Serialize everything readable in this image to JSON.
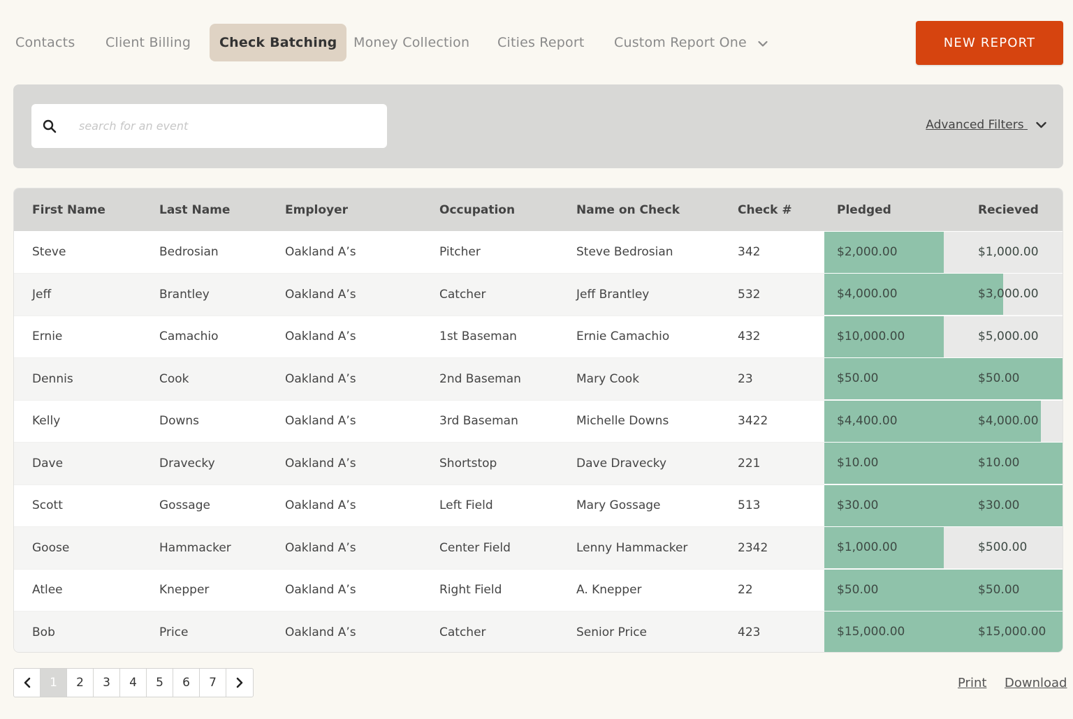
{
  "tabs": [
    {
      "label": "Contacts"
    },
    {
      "label": "Client Billing"
    },
    {
      "label": "Check Batching"
    },
    {
      "label": "Money Collection"
    },
    {
      "label": "Cities Report"
    },
    {
      "label": "Custom Report One"
    }
  ],
  "active_tab": "Check Batching",
  "new_report_label": "NEW REPORT",
  "search": {
    "placeholder": "search for an event",
    "value": ""
  },
  "advanced_filters_label": "Advanced Filters",
  "table": {
    "columns": [
      "First Name",
      "Last Name",
      "Employer",
      "Occupation",
      "Name on Check",
      "Check #",
      "Pledged",
      "Recieved"
    ],
    "rows": [
      {
        "first": "Steve",
        "last": "Bedrosian",
        "employer": "Oakland A’s",
        "occupation": "Pitcher",
        "name_on_check": "Steve Bedrosian",
        "check": "342",
        "pledged": "$2,000.00",
        "received": "$1,000.00",
        "received_fraction": 0.5
      },
      {
        "first": "Jeff",
        "last": "Brantley",
        "employer": "Oakland A’s",
        "occupation": "Catcher",
        "name_on_check": "Jeff Brantley",
        "check": "532",
        "pledged": "$4,000.00",
        "received": "$3,000.00",
        "received_fraction": 0.75
      },
      {
        "first": "Ernie",
        "last": "Camachio",
        "employer": "Oakland A’s",
        "occupation": "1st Baseman",
        "name_on_check": "Ernie Camachio",
        "check": "432",
        "pledged": "$10,000.00",
        "received": "$5,000.00",
        "received_fraction": 0.5
      },
      {
        "first": "Dennis",
        "last": "Cook",
        "employer": "Oakland A’s",
        "occupation": "2nd Baseman",
        "name_on_check": "Mary Cook",
        "check": "23",
        "pledged": "$50.00",
        "received": "$50.00",
        "received_fraction": 1.0
      },
      {
        "first": "Kelly",
        "last": "Downs",
        "employer": "Oakland A’s",
        "occupation": "3rd Baseman",
        "name_on_check": "Michelle Downs",
        "check": "3422",
        "pledged": "$4,400.00",
        "received": "$4,000.00",
        "received_fraction": 0.909
      },
      {
        "first": "Dave",
        "last": "Dravecky",
        "employer": "Oakland A’s",
        "occupation": "Shortstop",
        "name_on_check": "Dave Dravecky",
        "check": "221",
        "pledged": "$10.00",
        "received": "$10.00",
        "received_fraction": 1.0
      },
      {
        "first": "Scott",
        "last": "Gossage",
        "employer": "Oakland A’s",
        "occupation": "Left Field",
        "name_on_check": "Mary Gossage",
        "check": "513",
        "pledged": "$30.00",
        "received": "$30.00",
        "received_fraction": 1.0
      },
      {
        "first": "Goose",
        "last": "Hammacker",
        "employer": "Oakland A’s",
        "occupation": "Center Field",
        "name_on_check": "Lenny Hammacker",
        "check": "2342",
        "pledged": "$1,000.00",
        "received": "$500.00",
        "received_fraction": 0.5
      },
      {
        "first": "Atlee",
        "last": "Knepper",
        "employer": "Oakland A’s",
        "occupation": "Right Field",
        "name_on_check": "A. Knepper",
        "check": "22",
        "pledged": "$50.00",
        "received": "$50.00",
        "received_fraction": 1.0
      },
      {
        "first": "Bob",
        "last": "Price",
        "employer": "Oakland A’s",
        "occupation": "Catcher",
        "name_on_check": "Senior Price",
        "check": "423",
        "pledged": "$15,000.00",
        "received": "$15,000.00",
        "received_fraction": 1.0
      }
    ]
  },
  "pagination": {
    "pages": [
      "1",
      "2",
      "3",
      "4",
      "5",
      "6",
      "7"
    ],
    "current": "1"
  },
  "print_label": "Print",
  "download_label": "Download",
  "colors": {
    "accent": "#d6440f",
    "progress_fill": "#8fc2aa",
    "active_tab_bg": "#dfd3c4"
  },
  "icons": {
    "search": "search-icon",
    "tab_dropdown": "chevron-down-icon",
    "filters_dropdown": "chevron-down-icon",
    "prev": "chevron-left-icon",
    "next": "chevron-right-icon"
  }
}
